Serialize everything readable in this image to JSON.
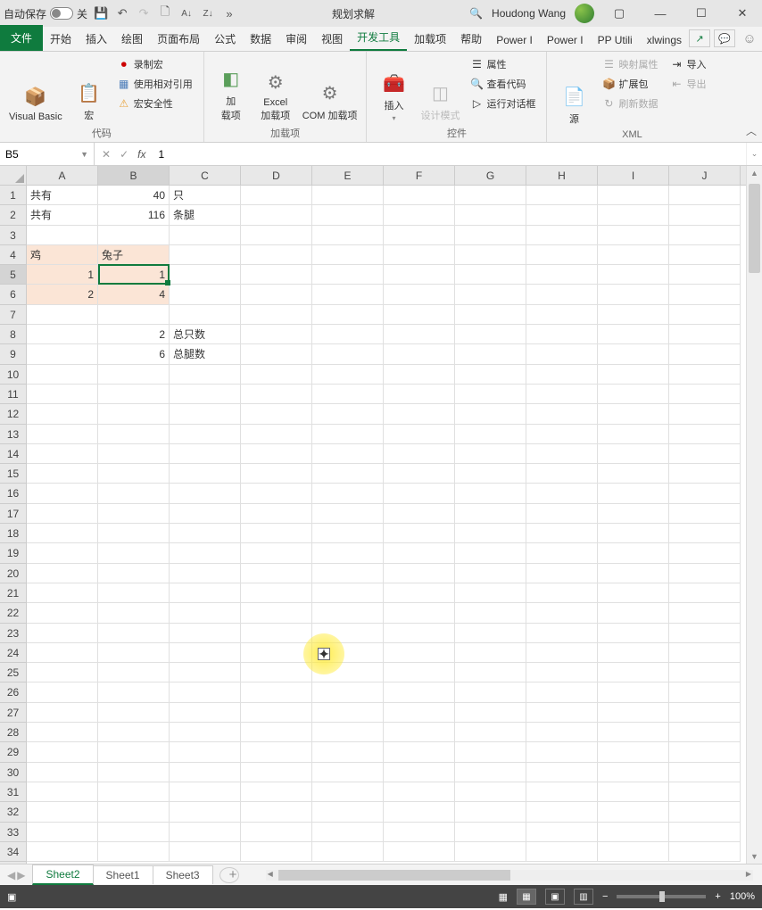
{
  "titlebar": {
    "autosave_label": "自动保存",
    "autosave_state": "关",
    "center_label": "规划求解",
    "search_icon": "🔍",
    "user_name": "Houdong Wang"
  },
  "tabs": {
    "file": "文件",
    "items": [
      "开始",
      "插入",
      "绘图",
      "页面布局",
      "公式",
      "数据",
      "审阅",
      "视图",
      "开发工具",
      "加载项",
      "帮助",
      "Power I",
      "Power I",
      "PP Utili",
      "xlwings"
    ],
    "active_index": 8
  },
  "ribbon": {
    "g1": {
      "label": "代码",
      "visual_basic": "Visual Basic",
      "macro": "宏",
      "record": "录制宏",
      "relative": "使用相对引用",
      "security": "宏安全性"
    },
    "g2": {
      "label": "加载项",
      "addins": "加\n载项",
      "excel_addins": "Excel\n加载项",
      "com_addins": "COM 加载项"
    },
    "g3": {
      "label": "控件",
      "insert": "插入",
      "design": "设计模式",
      "properties": "属性",
      "view_code": "查看代码",
      "run_dialog": "运行对话框"
    },
    "g4": {
      "label": "XML",
      "source": "源",
      "map_props": "映射属性",
      "expansion": "扩展包",
      "refresh": "刷新数据",
      "import": "导入",
      "export": "导出"
    }
  },
  "namebox": "B5",
  "formula": "1",
  "columns": [
    "A",
    "B",
    "C",
    "D",
    "E",
    "F",
    "G",
    "H",
    "I",
    "J"
  ],
  "rows": [
    "1",
    "2",
    "3",
    "4",
    "5",
    "6",
    "7",
    "8",
    "9",
    "10",
    "11",
    "12",
    "13",
    "14",
    "15",
    "16",
    "17",
    "18",
    "19",
    "20",
    "21",
    "22",
    "23",
    "24",
    "25",
    "26",
    "27",
    "28",
    "29",
    "30",
    "31",
    "32",
    "33",
    "34"
  ],
  "cells": {
    "A1": "共有",
    "B1": "40",
    "C1": "只",
    "A2": "共有",
    "B2": "116",
    "C2": "条腿",
    "A4": "鸡",
    "B4": "兔子",
    "A5": "1",
    "B5": "1",
    "A6": "2",
    "B6": "4",
    "B8": "2",
    "C8": "总只数",
    "B9": "6",
    "C9": "总腿数"
  },
  "sheets": {
    "items": [
      "Sheet2",
      "Sheet1",
      "Sheet3"
    ],
    "active_index": 0
  },
  "statusbar": {
    "zoom": "100%"
  }
}
